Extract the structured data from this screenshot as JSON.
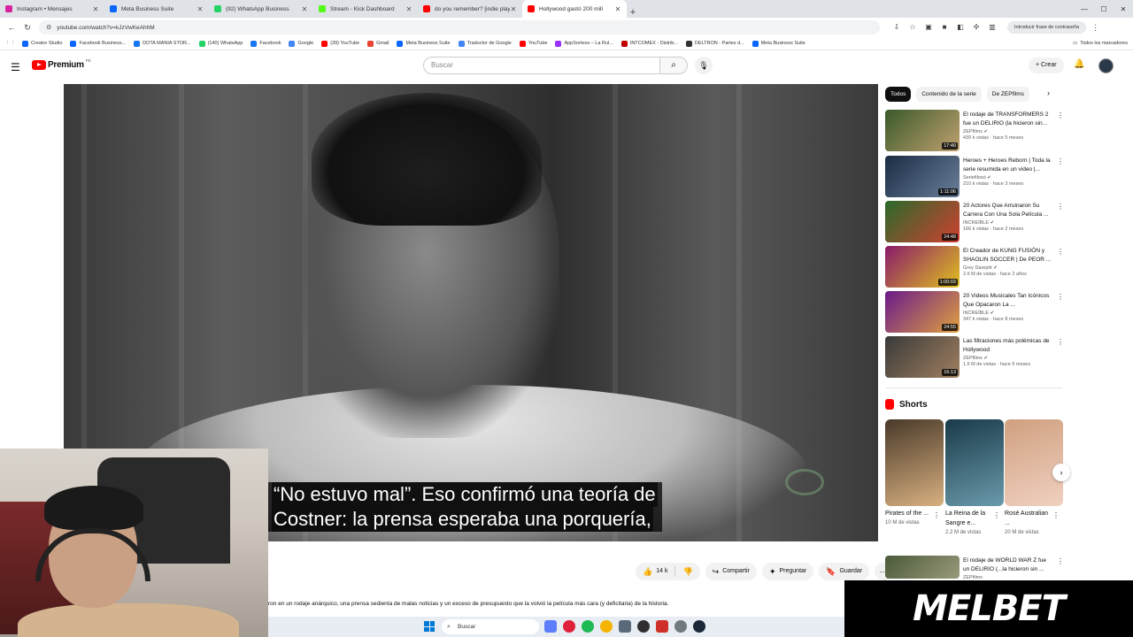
{
  "browser": {
    "tabs": [
      {
        "label": "Instagram • Mensajes",
        "color": "#d6249f",
        "active": false
      },
      {
        "label": "Meta Business Suite",
        "color": "#0866ff",
        "active": false
      },
      {
        "label": "(92) WhatsApp Business",
        "color": "#25d366",
        "active": false
      },
      {
        "label": "Stream - Kick Dashboard",
        "color": "#53fc18",
        "active": false
      },
      {
        "label": "do you remember? [indie playli",
        "color": "#ff0000",
        "active": false
      },
      {
        "label": "Hollywood gastó 200 mill",
        "color": "#ff0000",
        "active": true
      }
    ],
    "url": "youtube.com/watch?v=kJzVwKeAhhM",
    "password_chip": "Introducir frase de contraseña",
    "bookmarks": [
      {
        "label": "Creator Studio",
        "color": "#0866ff"
      },
      {
        "label": "Facebook Business...",
        "color": "#0866ff"
      },
      {
        "label": "DOTA MANIA STOR...",
        "color": "#1877f2"
      },
      {
        "label": "(140) WhatsApp",
        "color": "#25d366"
      },
      {
        "label": "Facebook",
        "color": "#1877f2"
      },
      {
        "label": "Google",
        "color": "#4285f4"
      },
      {
        "label": "(39) YouTube",
        "color": "#ff0000"
      },
      {
        "label": "Gmail",
        "color": "#ea4335"
      },
      {
        "label": "Meta Business Suite",
        "color": "#0866ff"
      },
      {
        "label": "Traductor de Google",
        "color": "#4285f4"
      },
      {
        "label": "YouTube",
        "color": "#ff0000"
      },
      {
        "label": "AppSorteos – La Rul...",
        "color": "#9b30ff"
      },
      {
        "label": "INTCOMEX - Distrib...",
        "color": "#c00000"
      },
      {
        "label": "DELTRON - Partes d...",
        "color": "#333333"
      },
      {
        "label": "Meta Business Suite",
        "color": "#0866ff"
      }
    ],
    "all_bookmarks": "Todos los marcadores"
  },
  "youtube": {
    "logo_text": "Premium",
    "logo_country": "PE",
    "search_placeholder": "Buscar",
    "create_label": "Crear",
    "caption_line1": "“No estuvo mal”. Eso confirmó una teoría de",
    "caption_line2": "Costner: la prensa esperaba una porquería,",
    "actions": {
      "likes": "14 k",
      "share": "Compartir",
      "ask": "Preguntar",
      "save": "Guardar"
    },
    "description": "ron en un rodaje anárquico, una prensa sedienta de malas noticias y un exceso de presupuesto que la volvió la película más cara (y deficitaria) de la historia."
  },
  "sidebar": {
    "chips": [
      "Todos",
      "Contenido de la serie",
      "De ZEPfilms"
    ],
    "recommendations": [
      {
        "title": "El rodaje de TRANSFORMERS 2 fue un DELIRIO (la hicieron sin...",
        "channel": "ZEPfilms",
        "meta": "430 k vistas · hace 5 meses",
        "duration": "17:40",
        "c1": "#3a5a2a",
        "c2": "#c0a070"
      },
      {
        "title": "Heroes + Heroes Reborn | Toda la serie resumida en un video |...",
        "channel": "Seriefilosó",
        "meta": "210 k vistas · hace 3 meses",
        "duration": "1:11:06",
        "c1": "#1b2c44",
        "c2": "#6a7f9a"
      },
      {
        "title": "20 Actores Que Arruinaron Su Carrera Con Una Sola Película ...",
        "channel": "INCREÍBLE",
        "meta": "166 k vistas · hace 2 meses",
        "duration": "24:48",
        "c1": "#2a6a2a",
        "c2": "#d04030"
      },
      {
        "title": "El Creador de KUNG FUSIÓN y SHAOLIN SOCCER | De PEOR ...",
        "channel": "Grey Darepilr",
        "meta": "2.6 M de vistas · hace 2 años",
        "duration": "1:00:03",
        "c1": "#8a1a6a",
        "c2": "#e0c020"
      },
      {
        "title": "20 Videos Musicales Tan Icónicos Que Opacaron La ...",
        "channel": "INCREÍBLE",
        "meta": "347 k vistas · hace 8 meses",
        "duration": "24:55",
        "c1": "#6a1a8a",
        "c2": "#e0a040"
      },
      {
        "title": "Las filtraciones más polémicas de Hollywood",
        "channel": "ZEPfilms",
        "meta": "1.6 M de vistas · hace 5 meses",
        "duration": "16:13",
        "c1": "#3a3a3a",
        "c2": "#a08060"
      }
    ],
    "shorts_title": "Shorts",
    "shorts": [
      {
        "title": "Pirates of the ...",
        "views": "10 M de vistas",
        "c1": "#4a3a2a",
        "c2": "#d8b080"
      },
      {
        "title": "La Reina de la Sangre e...",
        "views": "2.2 M de vistas",
        "c1": "#1a3a4a",
        "c2": "#6a9aaa"
      },
      {
        "title": "Rosé Australian ...",
        "views": "20 M de vistas",
        "c1": "#d0a080",
        "c2": "#f0d0c0"
      }
    ],
    "extra": {
      "title": "El rodaje de WORLD WAR Z fue un DELIRIO (...la hicieron sin ...",
      "channel": "ZEPfilms"
    }
  },
  "ad": {
    "text": "MELBET"
  },
  "taskbar": {
    "search": "Buscar"
  }
}
